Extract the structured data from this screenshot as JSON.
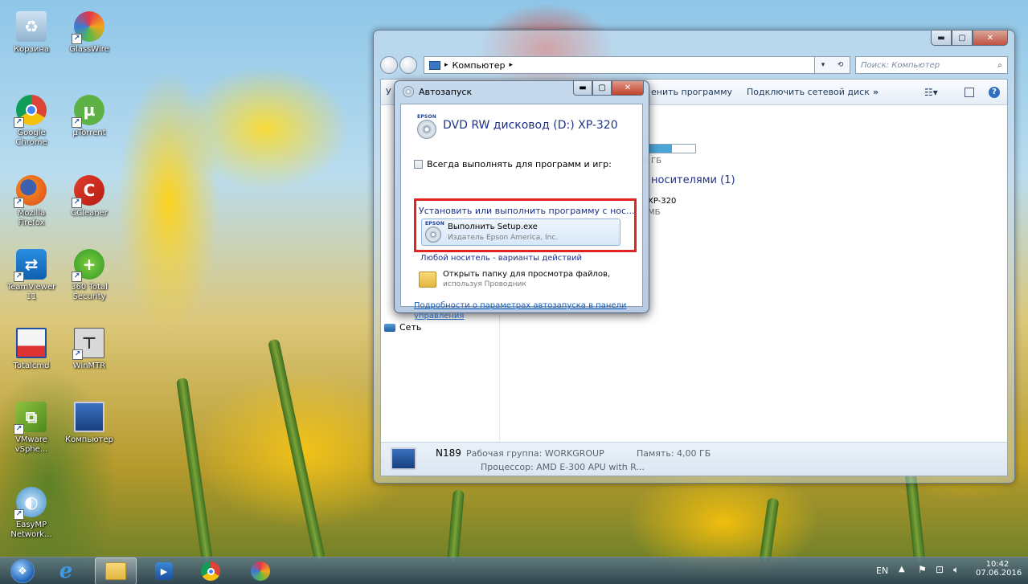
{
  "desktop": {
    "icons": [
      {
        "label": "Корзина",
        "icon": "recycle-bin-icon"
      },
      {
        "label": "GlassWire",
        "icon": "glasswire-icon"
      },
      {
        "label": "Google Chrome",
        "icon": "chrome-icon"
      },
      {
        "label": "µTorrent",
        "icon": "utorrent-icon"
      },
      {
        "label": "Mozilla Firefox",
        "icon": "firefox-icon"
      },
      {
        "label": "CCleaner",
        "icon": "ccleaner-icon"
      },
      {
        "label": "TeamViewer 11",
        "icon": "teamviewer-icon"
      },
      {
        "label": "360 Total Security",
        "icon": "360-security-icon"
      },
      {
        "label": "Totalcmd",
        "icon": "totalcmd-icon"
      },
      {
        "label": "WinMTR",
        "icon": "winmtr-icon"
      },
      {
        "label": "VMware vSphe...",
        "icon": "vmware-icon"
      },
      {
        "label": "Компьютер",
        "icon": "computer-icon"
      },
      {
        "label": "EasyMP Network...",
        "icon": "easymp-icon"
      }
    ]
  },
  "explorer": {
    "address": "Компьютер",
    "address_sep": "▸",
    "search_placeholder": "Поиск: Компьютер",
    "cmd_left_letter": "У",
    "cmd_uninstall": "енить программу",
    "cmd_map_drive": "Подключить сетевой диск",
    "cmd_more": "»",
    "drive_free_partial": "Б ГБ",
    "removable_header_partial": "носителями (1)",
    "removable_name_partial": "XP-320",
    "removable_size_partial": "МБ",
    "nav_network": "Сеть",
    "status_name": "N189",
    "status_workgroup": "Рабочая группа: WORKGROUP",
    "status_memory": "Память: 4,00 ГБ",
    "status_cpu": "Процессор: AMD E-300 APU with R..."
  },
  "autoplay": {
    "title": "Автозапуск",
    "device": "DVD RW дисковод (D:) XP-320",
    "always_checkbox": "Всегда выполнять для программ и игр:",
    "section_install": "Установить или выполнить программу с нос...",
    "run_setup": "Выполнить Setup.exe",
    "publisher": "Издатель Epson America, Inc.",
    "section_any": "Любой носитель - варианты действий",
    "open_folder": "Открыть папку для просмотра файлов,",
    "open_folder_sub": "используя Проводник",
    "link": "Подробности о параметрах автозапуска в панели управления",
    "epson": "EPSON"
  },
  "tray": {
    "lang": "EN",
    "time": "10:42",
    "date": "07.06.2016"
  }
}
